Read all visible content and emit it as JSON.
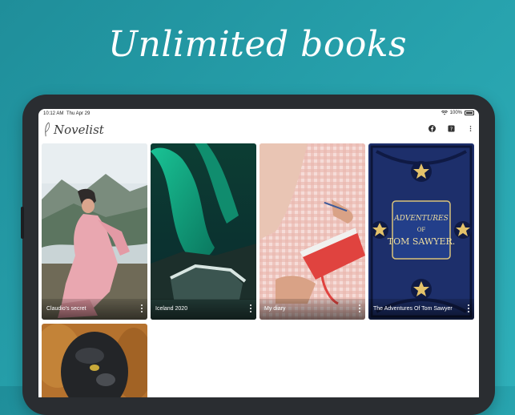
{
  "promo": {
    "headline": "Unlimited books"
  },
  "status_bar": {
    "time": "10:12 AM",
    "date": "Thu Apr 29",
    "battery": "100%"
  },
  "app": {
    "name": "Novelist",
    "actions": [
      {
        "icon": "facebook-icon"
      },
      {
        "icon": "help-icon"
      },
      {
        "icon": "more-vertical-icon"
      }
    ]
  },
  "books": [
    {
      "title": "Claudio's secret",
      "cover": "woman-pink-dress-mountains"
    },
    {
      "title": "Iceland 2020",
      "cover": "aurora-borealis"
    },
    {
      "title": "My diary",
      "cover": "hands-writing-notebook"
    },
    {
      "title": "The Adventures Of Tom Sawyer",
      "cover": "ornate-blue-book-cover"
    },
    {
      "title": "",
      "cover": "insect-close-up"
    }
  ],
  "cover_text": {
    "tom_line1": "ADVENTURES",
    "tom_line2": "OF",
    "tom_line3": "TOM SAWYER."
  },
  "colors": {
    "background": "#27a2ad",
    "accent_red": "#e0433f",
    "cover_blue": "#1d2f6b"
  }
}
